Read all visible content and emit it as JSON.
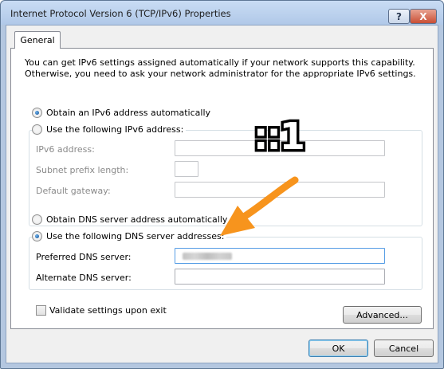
{
  "window": {
    "title": "Internet Protocol Version 6 (TCP/IPv6) Properties",
    "help_glyph": "?",
    "close_glyph": "X"
  },
  "tabs": [
    {
      "label": "General",
      "selected": true
    }
  ],
  "intro": {
    "line1": "You can get IPv6 settings assigned automatically if your network supports this capability.",
    "line2": "Otherwise, you need to ask your network administrator for the appropriate IPv6 settings."
  },
  "ip": {
    "auto_label": "Obtain an IPv6 address automatically",
    "auto_selected": true,
    "manual_label": "Use the following IPv6 address:",
    "manual_selected": false,
    "fields": [
      {
        "label": "IPv6 address:",
        "value": ""
      },
      {
        "label": "Subnet prefix length:",
        "value": ""
      },
      {
        "label": "Default gateway:",
        "value": ""
      }
    ]
  },
  "dns": {
    "auto_label": "Obtain DNS server address automatically",
    "auto_selected": false,
    "manual_label": "Use the following DNS server addresses:",
    "manual_selected": true,
    "fields": [
      {
        "label": "Preferred DNS server:",
        "value": "",
        "blurred": true
      },
      {
        "label": "Alternate DNS server:",
        "value": ""
      }
    ]
  },
  "validate": {
    "label": "Validate settings upon exit",
    "checked": false
  },
  "buttons": {
    "advanced": "Advanced...",
    "ok": "OK",
    "cancel": "Cancel"
  },
  "annotation": {
    "text": "::1",
    "color": "#f7941d"
  }
}
